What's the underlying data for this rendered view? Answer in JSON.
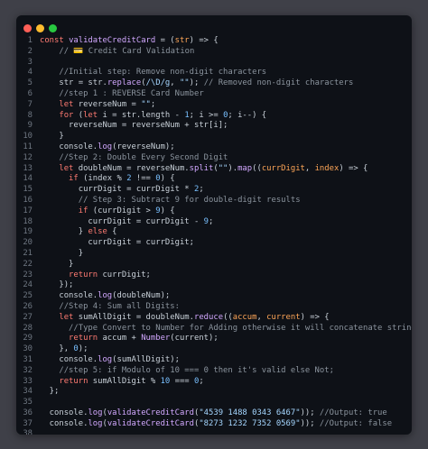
{
  "colors": {
    "page_background": "#3f4048",
    "editor_background": "#0e1117",
    "close_dot": "#ff5f57",
    "minimize_dot": "#febc2e",
    "maximize_dot": "#28c840",
    "line_number": "#6e7681",
    "keyword": "#ff7b72",
    "function": "#d2a8ff",
    "comment": "#8b949e",
    "string": "#a5d6ff",
    "number": "#79c0ff",
    "variable": "#ffa657",
    "plain": "#c9d1d9"
  },
  "window_controls": [
    "close-dot",
    "minimize-dot",
    "maximize-dot"
  ],
  "code": [
    {
      "n": "1",
      "t": [
        [
          "kw",
          "const "
        ],
        [
          "fn",
          "validateCreditCard"
        ],
        [
          "pl",
          " = ("
        ],
        [
          "vr",
          "str"
        ],
        [
          "pl",
          ") => {"
        ]
      ]
    },
    {
      "n": "2",
      "t": [
        [
          "cm",
          "    // 💳 Credit Card Validation"
        ]
      ]
    },
    {
      "n": "3",
      "t": []
    },
    {
      "n": "4",
      "t": [
        [
          "cm",
          "    //Initial step: Remove non-digit characters"
        ]
      ]
    },
    {
      "n": "5",
      "t": [
        [
          "pl",
          "    str = str."
        ],
        [
          "fn",
          "replace"
        ],
        [
          "pl",
          "("
        ],
        [
          "st",
          "/\\D/g"
        ],
        [
          "pl",
          ", "
        ],
        [
          "st",
          "\"\""
        ],
        [
          "pl",
          "); "
        ],
        [
          "cm",
          "// Removed non-digit characters"
        ]
      ]
    },
    {
      "n": "6",
      "t": [
        [
          "cm",
          "    //step 1 : REVERSE Card Number"
        ]
      ]
    },
    {
      "n": "7",
      "t": [
        [
          "kw",
          "    let "
        ],
        [
          "pl",
          "reverseNum = "
        ],
        [
          "st",
          "\"\""
        ],
        [
          "pl",
          ";"
        ]
      ]
    },
    {
      "n": "8",
      "t": [
        [
          "kw",
          "    for "
        ],
        [
          "pl",
          "("
        ],
        [
          "kw",
          "let "
        ],
        [
          "pl",
          "i = str.length - "
        ],
        [
          "nu",
          "1"
        ],
        [
          "pl",
          "; i >= "
        ],
        [
          "nu",
          "0"
        ],
        [
          "pl",
          "; i--) {"
        ]
      ]
    },
    {
      "n": "9",
      "t": [
        [
          "pl",
          "      reverseNum = reverseNum + str[i];"
        ]
      ]
    },
    {
      "n": "10",
      "t": [
        [
          "pl",
          "    }"
        ]
      ]
    },
    {
      "n": "11",
      "t": [
        [
          "pl",
          "    console."
        ],
        [
          "fn",
          "log"
        ],
        [
          "pl",
          "(reverseNum);"
        ]
      ]
    },
    {
      "n": "12",
      "t": [
        [
          "cm",
          "    //Step 2: Double Every Second Digit"
        ]
      ]
    },
    {
      "n": "13",
      "t": [
        [
          "kw",
          "    let "
        ],
        [
          "pl",
          "doubleNum = reverseNum."
        ],
        [
          "fn",
          "split"
        ],
        [
          "pl",
          "("
        ],
        [
          "st",
          "\"\""
        ],
        [
          "pl",
          ")."
        ],
        [
          "fn",
          "map"
        ],
        [
          "pl",
          "(("
        ],
        [
          "vr",
          "currDigit"
        ],
        [
          "pl",
          ", "
        ],
        [
          "vr",
          "index"
        ],
        [
          "pl",
          ") => {"
        ]
      ]
    },
    {
      "n": "14",
      "t": [
        [
          "kw",
          "      if "
        ],
        [
          "pl",
          "(index % "
        ],
        [
          "nu",
          "2"
        ],
        [
          "pl",
          " !== "
        ],
        [
          "nu",
          "0"
        ],
        [
          "pl",
          ") {"
        ]
      ]
    },
    {
      "n": "15",
      "t": [
        [
          "pl",
          "        currDigit = currDigit * "
        ],
        [
          "nu",
          "2"
        ],
        [
          "pl",
          ";"
        ]
      ]
    },
    {
      "n": "16",
      "t": [
        [
          "cm",
          "        // Step 3: Subtract 9 for double-digit results"
        ]
      ]
    },
    {
      "n": "17",
      "t": [
        [
          "kw",
          "        if "
        ],
        [
          "pl",
          "(currDigit > "
        ],
        [
          "nu",
          "9"
        ],
        [
          "pl",
          ") {"
        ]
      ]
    },
    {
      "n": "18",
      "t": [
        [
          "pl",
          "          currDigit = currDigit - "
        ],
        [
          "nu",
          "9"
        ],
        [
          "pl",
          ";"
        ]
      ]
    },
    {
      "n": "19",
      "t": [
        [
          "pl",
          "        } "
        ],
        [
          "kw",
          "else "
        ],
        [
          "pl",
          "{"
        ]
      ]
    },
    {
      "n": "20",
      "t": [
        [
          "pl",
          "          currDigit = currDigit;"
        ]
      ]
    },
    {
      "n": "21",
      "t": [
        [
          "pl",
          "        }"
        ]
      ]
    },
    {
      "n": "22",
      "t": [
        [
          "pl",
          "      }"
        ]
      ]
    },
    {
      "n": "23",
      "t": [
        [
          "kw",
          "      return "
        ],
        [
          "pl",
          "currDigit;"
        ]
      ]
    },
    {
      "n": "24",
      "t": [
        [
          "pl",
          "    });"
        ]
      ]
    },
    {
      "n": "25",
      "t": [
        [
          "pl",
          "    console."
        ],
        [
          "fn",
          "log"
        ],
        [
          "pl",
          "(doubleNum);"
        ]
      ]
    },
    {
      "n": "26",
      "t": [
        [
          "cm",
          "    //Step 4: Sum all Digits:"
        ]
      ]
    },
    {
      "n": "27",
      "t": [
        [
          "kw",
          "    let "
        ],
        [
          "pl",
          "sumAllDigit = doubleNum."
        ],
        [
          "fn",
          "reduce"
        ],
        [
          "pl",
          "(("
        ],
        [
          "vr",
          "accum"
        ],
        [
          "pl",
          ", "
        ],
        [
          "vr",
          "current"
        ],
        [
          "pl",
          ") => {"
        ]
      ]
    },
    {
      "n": "28",
      "t": [
        [
          "cm",
          "      //Type Convert to Number for Adding otherwise it will concatenate string"
        ]
      ]
    },
    {
      "n": "29",
      "t": [
        [
          "kw",
          "      return "
        ],
        [
          "pl",
          "accum + "
        ],
        [
          "fn",
          "Number"
        ],
        [
          "pl",
          "(current);"
        ]
      ]
    },
    {
      "n": "30",
      "t": [
        [
          "pl",
          "    }, "
        ],
        [
          "nu",
          "0"
        ],
        [
          "pl",
          ");"
        ]
      ]
    },
    {
      "n": "31",
      "t": [
        [
          "pl",
          "    console."
        ],
        [
          "fn",
          "log"
        ],
        [
          "pl",
          "(sumAllDigit);"
        ]
      ]
    },
    {
      "n": "32",
      "t": [
        [
          "cm",
          "    //step 5: if Modulo of 10 === 0 then it's valid else Not;"
        ]
      ]
    },
    {
      "n": "33",
      "t": [
        [
          "kw",
          "    return "
        ],
        [
          "pl",
          "sumAllDigit % "
        ],
        [
          "nu",
          "10"
        ],
        [
          "pl",
          " === "
        ],
        [
          "nu",
          "0"
        ],
        [
          "pl",
          ";"
        ]
      ]
    },
    {
      "n": "34",
      "t": [
        [
          "pl",
          "  };"
        ]
      ]
    },
    {
      "n": "35",
      "t": []
    },
    {
      "n": "36",
      "t": [
        [
          "pl",
          "  console."
        ],
        [
          "fn",
          "log"
        ],
        [
          "pl",
          "("
        ],
        [
          "fn",
          "validateCreditCard"
        ],
        [
          "pl",
          "("
        ],
        [
          "st",
          "\"4539 1488 0343 6467\""
        ],
        [
          "pl",
          "));"
        ],
        [
          "cm",
          " //Output: true"
        ]
      ]
    },
    {
      "n": "37",
      "t": [
        [
          "pl",
          "  console."
        ],
        [
          "fn",
          "log"
        ],
        [
          "pl",
          "("
        ],
        [
          "fn",
          "validateCreditCard"
        ],
        [
          "pl",
          "("
        ],
        [
          "st",
          "\"8273 1232 7352 0569\""
        ],
        [
          "pl",
          "));"
        ],
        [
          "cm",
          " //Output: false"
        ]
      ]
    },
    {
      "n": "38",
      "t": []
    }
  ]
}
